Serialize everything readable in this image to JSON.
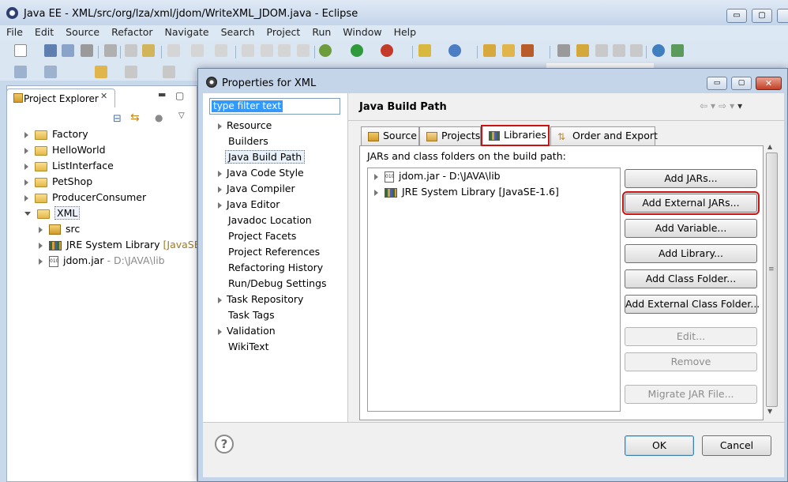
{
  "window": {
    "title": "Java EE - XML/src/org/lza/xml/jdom/WriteXML_JDOM.java - Eclipse",
    "controls": {
      "minimize": "▭",
      "maximize": "▢",
      "close": "✕"
    }
  },
  "menubar": {
    "items": [
      "File",
      "Edit",
      "Source",
      "Refactor",
      "Navigate",
      "Search",
      "Project",
      "Run",
      "Window",
      "Help"
    ]
  },
  "explorer": {
    "tab_label": "Project Explorer",
    "projects": [
      {
        "label": "Factory"
      },
      {
        "label": "HelloWorld"
      },
      {
        "label": "ListInterface"
      },
      {
        "label": "PetShop"
      },
      {
        "label": "ProducerConsumer"
      }
    ],
    "open_project": {
      "label": "XML",
      "children": [
        {
          "label": "src",
          "suffix": ""
        },
        {
          "label": "JRE System Library",
          "suffix": "[JavaSE-"
        },
        {
          "label": "jdom.jar",
          "suffix": "- D:\\JAVA\\lib"
        }
      ]
    }
  },
  "dialog": {
    "title": "Properties for XML",
    "filter": {
      "value": "type filter text"
    },
    "nav": [
      {
        "label": "Resource",
        "expandable": true
      },
      {
        "label": "Builders",
        "expandable": false
      },
      {
        "label": "Java Build Path",
        "expandable": false,
        "selected": true
      },
      {
        "label": "Java Code Style",
        "expandable": true
      },
      {
        "label": "Java Compiler",
        "expandable": true
      },
      {
        "label": "Java Editor",
        "expandable": true
      },
      {
        "label": "Javadoc Location",
        "expandable": false
      },
      {
        "label": "Project Facets",
        "expandable": false
      },
      {
        "label": "Project References",
        "expandable": false
      },
      {
        "label": "Refactoring History",
        "expandable": false
      },
      {
        "label": "Run/Debug Settings",
        "expandable": false
      },
      {
        "label": "Task Repository",
        "expandable": true
      },
      {
        "label": "Task Tags",
        "expandable": false
      },
      {
        "label": "Validation",
        "expandable": true
      },
      {
        "label": "WikiText",
        "expandable": false
      }
    ],
    "page_title": "Java Build Path",
    "tabs": [
      {
        "label": "Source",
        "active": false
      },
      {
        "label": "Projects",
        "active": false
      },
      {
        "label": "Libraries",
        "active": true
      },
      {
        "label": "Order and Export",
        "active": false
      }
    ],
    "paths_label": "JARs and class folders on the build path:",
    "entries": [
      {
        "label": "jdom.jar - D:\\JAVA\\lib",
        "icon": "jar-icon"
      },
      {
        "label": "JRE System Library [JavaSE-1.6]",
        "icon": "library-icon"
      }
    ],
    "buttons": {
      "add_jars": "Add JARs...",
      "add_external_jars": "Add External JARs...",
      "add_variable": "Add Variable...",
      "add_library": "Add Library...",
      "add_class_folder": "Add Class Folder...",
      "add_external_class_folder": "Add External Class Folder...",
      "edit": "Edit...",
      "remove": "Remove",
      "migrate_jar": "Migrate JAR File..."
    },
    "help": "?",
    "ok": "OK",
    "cancel": "Cancel"
  },
  "colors": {
    "highlight_border": "#cc1111",
    "selection": "#3399ff"
  }
}
